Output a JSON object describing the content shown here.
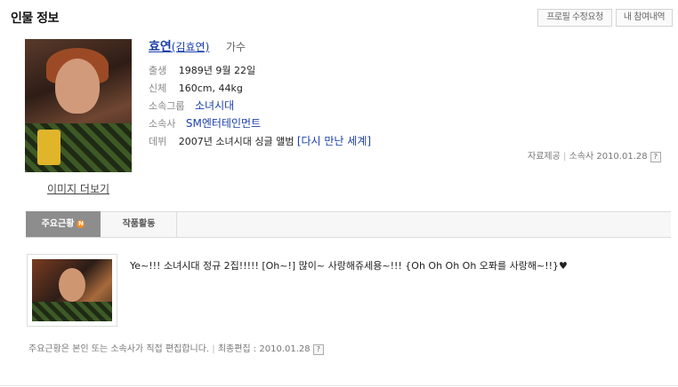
{
  "header": {
    "title": "인물 정보",
    "edit_request_label": "프로필 수정요청",
    "history_label": "내 참여내역"
  },
  "profile": {
    "name": "효연",
    "real_name": "(김효연)",
    "occupation": "가수",
    "more_images_label": "이미지 더보기",
    "fields": [
      {
        "label": "출생",
        "value": "1989년 9월 22일"
      },
      {
        "label": "신체",
        "value": "160cm, 44kg"
      },
      {
        "label": "소속그룹",
        "value": "소녀시대"
      },
      {
        "label": "소속사",
        "value": "SM엔터테인먼트"
      },
      {
        "label": "데뷔",
        "value": "2007년 소녀시대 싱글 앨범 ",
        "link": "[다시 만난 세계]"
      }
    ],
    "source_label": "자료제공",
    "source_value": "소속사 2010.01.28",
    "help_icon": "?"
  },
  "tabs": [
    {
      "label": "주요근황",
      "badge": "N",
      "active": true
    },
    {
      "label": "작품활동",
      "active": false
    }
  ],
  "news": {
    "text": "Ye~!!! 소녀시대 정규 2집!!!!! [Oh~!] 많이~ 사랑해쥬세용~!!! {Oh Oh Oh Oh 오퐈를 사랑해~!!}♥"
  },
  "footer": {
    "note": "주요근황은 본인 또는 소속사가 직접 편집합니다.",
    "last_edit_label": "최종편집 : 2010.01.28"
  },
  "colors": {
    "link": "#1a3fa8",
    "tab_active_bg": "#8d8d8d",
    "badge": "#ff8a1a"
  }
}
